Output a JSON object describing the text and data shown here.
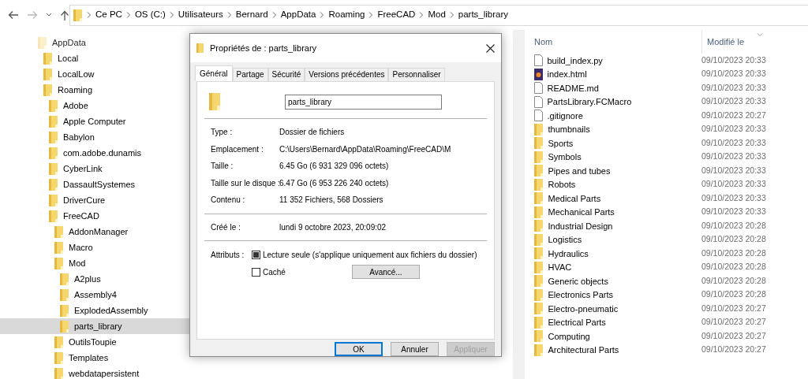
{
  "address_bar": {
    "path": [
      "Ce PC",
      "OS (C:)",
      "Utilisateurs",
      "Bernard",
      "AppData",
      "Roaming",
      "FreeCAD",
      "Mod",
      "parts_library"
    ]
  },
  "tree": [
    {
      "label": "AppData",
      "hidden": true,
      "selected": false,
      "children": [
        {
          "label": "Local",
          "hidden": false,
          "selected": false
        },
        {
          "label": "LocalLow",
          "hidden": false,
          "selected": false
        },
        {
          "label": "Roaming",
          "hidden": false,
          "selected": false,
          "children": [
            {
              "label": "Adobe",
              "hidden": false,
              "selected": false
            },
            {
              "label": "Apple Computer",
              "hidden": false,
              "selected": false
            },
            {
              "label": "Babylon",
              "hidden": false,
              "selected": false
            },
            {
              "label": "com.adobe.dunamis",
              "hidden": false,
              "selected": false
            },
            {
              "label": "CyberLink",
              "hidden": false,
              "selected": false
            },
            {
              "label": "DassaultSystemes",
              "hidden": false,
              "selected": false
            },
            {
              "label": "DriverCure",
              "hidden": false,
              "selected": false
            },
            {
              "label": "FreeCAD",
              "hidden": false,
              "selected": false,
              "children": [
                {
                  "label": "AddonManager",
                  "hidden": false,
                  "selected": false
                },
                {
                  "label": "Macro",
                  "hidden": false,
                  "selected": false
                },
                {
                  "label": "Mod",
                  "hidden": false,
                  "selected": false,
                  "children": [
                    {
                      "label": "A2plus",
                      "hidden": false,
                      "selected": false
                    },
                    {
                      "label": "Assembly4",
                      "hidden": false,
                      "selected": false
                    },
                    {
                      "label": "ExplodedAssembly",
                      "hidden": false,
                      "selected": false
                    },
                    {
                      "label": "parts_library",
                      "hidden": false,
                      "selected": true
                    }
                  ]
                },
                {
                  "label": "OutilsToupie",
                  "hidden": false,
                  "selected": false
                },
                {
                  "label": "Templates",
                  "hidden": false,
                  "selected": false
                },
                {
                  "label": "webdatapersistent",
                  "hidden": false,
                  "selected": false
                }
              ]
            }
          ]
        }
      ]
    }
  ],
  "file_list": {
    "columns": [
      "Nom",
      "Modifié le"
    ],
    "rows": [
      {
        "kind": "file",
        "name": "build_index.py",
        "modified": "09/10/2023 20:33"
      },
      {
        "kind": "html",
        "name": "index.html",
        "modified": "09/10/2023 20:33"
      },
      {
        "kind": "file",
        "name": "README.md",
        "modified": "09/10/2023 20:33"
      },
      {
        "kind": "file",
        "name": "PartsLibrary.FCMacro",
        "modified": "09/10/2023 20:33"
      },
      {
        "kind": "file",
        "name": ".gitignore",
        "modified": "09/10/2023 20:27"
      },
      {
        "kind": "folder",
        "name": "thumbnails",
        "modified": "09/10/2023 20:33"
      },
      {
        "kind": "folder",
        "name": "Sports",
        "modified": "09/10/2023 20:33"
      },
      {
        "kind": "folder",
        "name": "Symbols",
        "modified": "09/10/2023 20:33"
      },
      {
        "kind": "folder",
        "name": "Pipes and tubes",
        "modified": "09/10/2023 20:33"
      },
      {
        "kind": "folder",
        "name": "Robots",
        "modified": "09/10/2023 20:33"
      },
      {
        "kind": "folder",
        "name": "Medical Parts",
        "modified": "09/10/2023 20:33"
      },
      {
        "kind": "folder",
        "name": "Mechanical Parts",
        "modified": "09/10/2023 20:33"
      },
      {
        "kind": "folder",
        "name": "Industrial Design",
        "modified": "09/10/2023 20:28"
      },
      {
        "kind": "folder",
        "name": "Logistics",
        "modified": "09/10/2023 20:28"
      },
      {
        "kind": "folder",
        "name": "Hydraulics",
        "modified": "09/10/2023 20:28"
      },
      {
        "kind": "folder",
        "name": "HVAC",
        "modified": "09/10/2023 20:28"
      },
      {
        "kind": "folder",
        "name": "Generic objects",
        "modified": "09/10/2023 20:28"
      },
      {
        "kind": "folder",
        "name": "Electronics Parts",
        "modified": "09/10/2023 20:28"
      },
      {
        "kind": "folder",
        "name": "Electro-pneumatic",
        "modified": "09/10/2023 20:27"
      },
      {
        "kind": "folder",
        "name": "Electrical Parts",
        "modified": "09/10/2023 20:27"
      },
      {
        "kind": "folder",
        "name": "Computing",
        "modified": "09/10/2023 20:27"
      },
      {
        "kind": "folder",
        "name": "Architectural Parts",
        "modified": "09/10/2023 20:27"
      }
    ]
  },
  "dialog": {
    "title": "Propriétés de : parts_library",
    "tabs": [
      {
        "label": "Général",
        "selected": true
      },
      {
        "label": "Partage",
        "selected": false
      },
      {
        "label": "Sécurité",
        "selected": false
      },
      {
        "label": "Versions précédentes",
        "selected": false
      },
      {
        "label": "Personnaliser",
        "selected": false
      }
    ],
    "name_field": {
      "value": "parts_library"
    },
    "properties": [
      {
        "label": "Type :",
        "value": "Dossier de fichiers"
      },
      {
        "label": "Emplacement :",
        "value": "C:\\Users\\Bernard\\AppData\\Roaming\\FreeCAD\\M"
      },
      {
        "label": "Taille :",
        "value": "6.45 Go (6 931 329 096 octets)"
      },
      {
        "label": "Taille sur le disque :",
        "value": "6.47 Go (6 953 226 240 octets)"
      },
      {
        "label": "Contenu :",
        "value": "11 352 Fichiers, 568 Dossiers"
      }
    ],
    "created": {
      "label": "Créé le :",
      "value": "lundi 9 octobre 2023, 20:09:02"
    },
    "attributes": {
      "label": "Attributs :",
      "checkboxes": [
        {
          "label": "Lecture seule (s'applique uniquement aux fichiers du dossier)",
          "checked": false,
          "indeterminate": true
        },
        {
          "label": "Caché",
          "checked": false,
          "indeterminate": false
        }
      ],
      "advanced_button": "Avancé..."
    },
    "buttons": [
      {
        "label": "OK",
        "default": true,
        "disabled": false
      },
      {
        "label": "Annuler",
        "default": false,
        "disabled": false
      },
      {
        "label": "Appliquer",
        "default": false,
        "disabled": true
      }
    ]
  }
}
